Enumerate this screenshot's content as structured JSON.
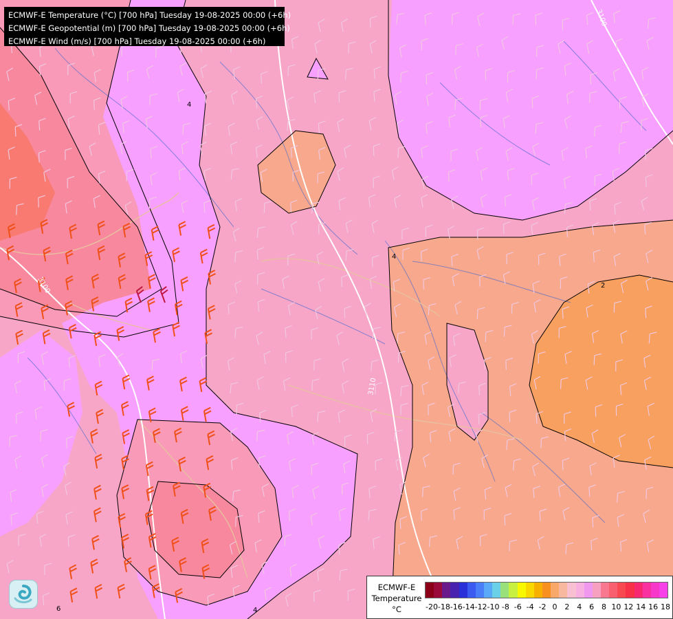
{
  "header": {
    "lines": [
      "ECMWF-E Temperature (°C) [700 hPa] Tuesday 19-08-2025 00:00 (+6h)",
      "ECMWF-E Geopotential (m) [700 hPa] Tuesday 19-08-2025 00:00 (+6h)",
      "ECMWF-E Wind (m/s) [700 hPa] Tuesday 19-08-2025 00:00 (+6h)"
    ]
  },
  "legend": {
    "title_lines": [
      "ECMWF-E",
      "Temperature",
      "°C"
    ],
    "tick_labels": [
      "-20",
      "-18",
      "-16",
      "-14",
      "-12",
      "-10",
      "-8",
      "-6",
      "-4",
      "-2",
      "0",
      "2",
      "4",
      "6",
      "8",
      "10",
      "12",
      "14",
      "16",
      "18"
    ],
    "colors": [
      "#8b0018",
      "#9a0a3a",
      "#6a1a8a",
      "#4a22b0",
      "#2a30d8",
      "#3a5af0",
      "#4a7ef8",
      "#5aa8f8",
      "#6ad0e8",
      "#9ae07a",
      "#c8f040",
      "#f8f800",
      "#f8d800",
      "#f8b000",
      "#f89020",
      "#f8a868",
      "#f8b8a0",
      "#f8c0d0",
      "#f8b0e0",
      "#f098f0",
      "#f8a0c0",
      "#f87890",
      "#f86070",
      "#f84850",
      "#f83048",
      "#f82870",
      "#f830a0",
      "#f838c8",
      "#f840e8"
    ]
  },
  "map": {
    "colors": {
      "band_2_4": "#f8a88c",
      "band_0_2": "#f8a060",
      "band_4_6": "#f7a6c8",
      "band_6_8": "#f8a0ff",
      "band_8_10": "#f89ab8",
      "band_10_12": "#f8889e",
      "band_12_14": "#f87a70",
      "isotherm": "#000000",
      "geopotential": "#ffffff",
      "coast": "#e8c0a0",
      "rivers": "#4a6ad0",
      "wind_light": "#f0c8e0",
      "wind_strong": "#f05018",
      "wind_max": "#c01840"
    },
    "geopotential_labels": [
      "3100",
      "3110",
      "3100"
    ],
    "isotherm_labels": [
      "4",
      "4",
      "6",
      "2",
      "4"
    ]
  }
}
